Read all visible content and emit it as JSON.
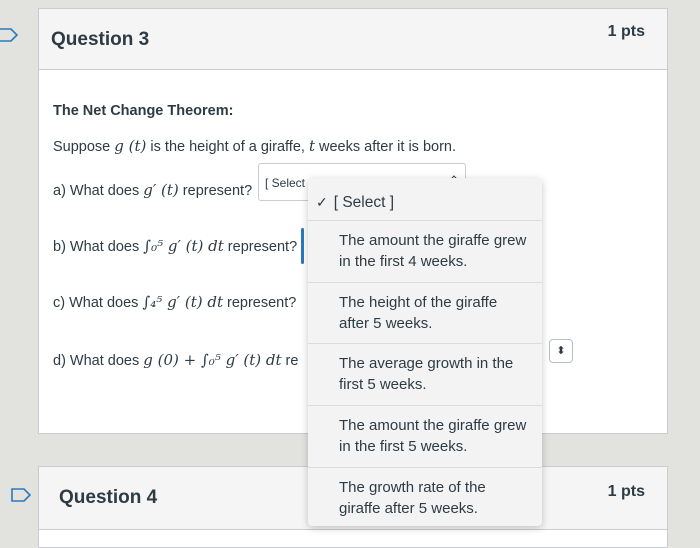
{
  "question3": {
    "title": "Question 3",
    "points": "1 pts",
    "heading": "The Net Change Theorem:",
    "intro_prefix": "Suppose ",
    "intro_func": "g (t)",
    "intro_mid": " is the height of a giraffe, ",
    "intro_var": "t",
    "intro_suffix": " weeks after it is born.",
    "part_a_prefix": "a) What does ",
    "part_a_math": "g′ (t)",
    "part_a_suffix": " represent?",
    "part_a_select": "[ Select",
    "part_b_prefix": "b) What does ",
    "part_b_math": "∫₀⁵ g′ (t) dt",
    "part_b_suffix": " represent?",
    "part_c_prefix": "c) What does ",
    "part_c_math": "∫₄⁵ g′ (t) dt",
    "part_c_suffix": " represent?",
    "part_d_prefix": "d) What does ",
    "part_d_math": "g (0) + ∫₀⁵ g′ (t) dt",
    "part_d_suffix": " re"
  },
  "dropdown": {
    "selected": "[ Select ]",
    "options": [
      "The amount the giraffe grew in the first 4 weeks.",
      "The height of the giraffe after 5 weeks.",
      "The average growth in the first 5 weeks.",
      "The amount the giraffe grew in the first 5 weeks.",
      "The growth rate of the giraffe after 5 weeks."
    ]
  },
  "question4": {
    "title": "Question 4",
    "points": "1 pts"
  },
  "icons": {
    "flag": "flag-icon",
    "check": "check-icon",
    "caret": "chevron-up-icon",
    "stepper": "up-down-arrows-icon"
  },
  "colors": {
    "text": "#2d3b45",
    "header_bg": "#f5f5f5",
    "border": "#c7cdd1",
    "focus": "#2b7abc"
  }
}
